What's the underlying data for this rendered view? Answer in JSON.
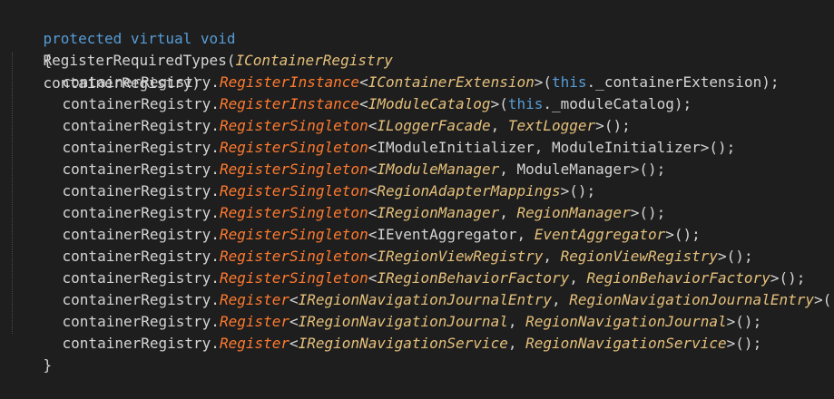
{
  "code": {
    "signature": {
      "modifiers": "protected virtual void",
      "method_name": "RegisterRequiredTypes",
      "open_paren": "(",
      "parameter_type": "IContainerRegistry",
      "parameter_name": "containerRegistry",
      "close_paren": ")"
    },
    "open_brace": "{",
    "close_brace": "}",
    "lines": [
      {
        "object": "containerRegistry",
        "dot": ".",
        "method": "RegisterInstance",
        "open_generic": "<",
        "type_1": "IContainerExtension",
        "separator": "",
        "type_2": "",
        "close_generic": ">",
        "args_open": "(",
        "this_keyword": "this",
        "arg_rest": "._containerExtension",
        "args_close": ");"
      },
      {
        "object": "containerRegistry",
        "dot": ".",
        "method": "RegisterInstance",
        "open_generic": "<",
        "type_1": "IModuleCatalog",
        "separator": "",
        "type_2": "",
        "close_generic": ">",
        "args_open": "(",
        "this_keyword": "this",
        "arg_rest": "._moduleCatalog",
        "args_close": ");"
      },
      {
        "object": "containerRegistry",
        "dot": ".",
        "method": "RegisterSingleton",
        "open_generic": "<",
        "type_1": "ILoggerFacade",
        "separator": ", ",
        "type_2": "TextLogger",
        "close_generic": ">",
        "args_open": "",
        "this_keyword": "",
        "arg_rest": "",
        "args_close": "();"
      },
      {
        "object": "containerRegistry",
        "dot": ".",
        "method": "RegisterSingleton",
        "open_generic": "<",
        "type_1": "IModuleInitializer",
        "separator": ", ",
        "type_2": "ModuleInitializer",
        "close_generic": ">",
        "args_open": "",
        "this_keyword": "",
        "arg_rest": "",
        "args_close": "();"
      },
      {
        "object": "containerRegistry",
        "dot": ".",
        "method": "RegisterSingleton",
        "open_generic": "<",
        "type_1": "IModuleManager",
        "separator": ", ",
        "type_2": "ModuleManager",
        "close_generic": ">",
        "args_open": "",
        "this_keyword": "",
        "arg_rest": "",
        "args_close": "();"
      },
      {
        "object": "containerRegistry",
        "dot": ".",
        "method": "RegisterSingleton",
        "open_generic": "<",
        "type_1": "RegionAdapterMappings",
        "separator": "",
        "type_2": "",
        "close_generic": ">",
        "args_open": "",
        "this_keyword": "",
        "arg_rest": "",
        "args_close": "();"
      },
      {
        "object": "containerRegistry",
        "dot": ".",
        "method": "RegisterSingleton",
        "open_generic": "<",
        "type_1": "IRegionManager",
        "separator": ", ",
        "type_2": "RegionManager",
        "close_generic": ">",
        "args_open": "",
        "this_keyword": "",
        "arg_rest": "",
        "args_close": "();"
      },
      {
        "object": "containerRegistry",
        "dot": ".",
        "method": "RegisterSingleton",
        "open_generic": "<",
        "type_1": "IEventAggregator",
        "separator": ", ",
        "type_2": "EventAggregator",
        "close_generic": ">",
        "args_open": "",
        "this_keyword": "",
        "arg_rest": "",
        "args_close": "();"
      },
      {
        "object": "containerRegistry",
        "dot": ".",
        "method": "RegisterSingleton",
        "open_generic": "<",
        "type_1": "IRegionViewRegistry",
        "separator": ", ",
        "type_2": "RegionViewRegistry",
        "close_generic": ">",
        "args_open": "",
        "this_keyword": "",
        "arg_rest": "",
        "args_close": "();"
      },
      {
        "object": "containerRegistry",
        "dot": ".",
        "method": "RegisterSingleton",
        "open_generic": "<",
        "type_1": "IRegionBehaviorFactory",
        "separator": ", ",
        "type_2": "RegionBehaviorFactory",
        "close_generic": ">",
        "args_open": "",
        "this_keyword": "",
        "arg_rest": "",
        "args_close": "();"
      },
      {
        "object": "containerRegistry",
        "dot": ".",
        "method": "Register",
        "open_generic": "<",
        "type_1": "IRegionNavigationJournalEntry",
        "separator": ", ",
        "type_2": "RegionNavigationJournalEntry",
        "close_generic": ">",
        "args_open": "",
        "this_keyword": "",
        "arg_rest": "",
        "args_close": "();"
      },
      {
        "object": "containerRegistry",
        "dot": ".",
        "method": "Register",
        "open_generic": "<",
        "type_1": "IRegionNavigationJournal",
        "separator": ", ",
        "type_2": "RegionNavigationJournal",
        "close_generic": ">",
        "args_open": "",
        "this_keyword": "",
        "arg_rest": "",
        "args_close": "();"
      },
      {
        "object": "containerRegistry",
        "dot": ".",
        "method": "Register",
        "open_generic": "<",
        "type_1": "IRegionNavigationService",
        "separator": ", ",
        "type_2": "RegionNavigationService",
        "close_generic": ">",
        "args_open": "",
        "this_keyword": "",
        "arg_rest": "",
        "args_close": "();"
      }
    ]
  },
  "theme": {
    "background": "#1e1e1e",
    "keyword": "#569cd6",
    "type": "#e5c07b",
    "method_call": "#ff7a2f",
    "plain": "#d4d4d4"
  }
}
